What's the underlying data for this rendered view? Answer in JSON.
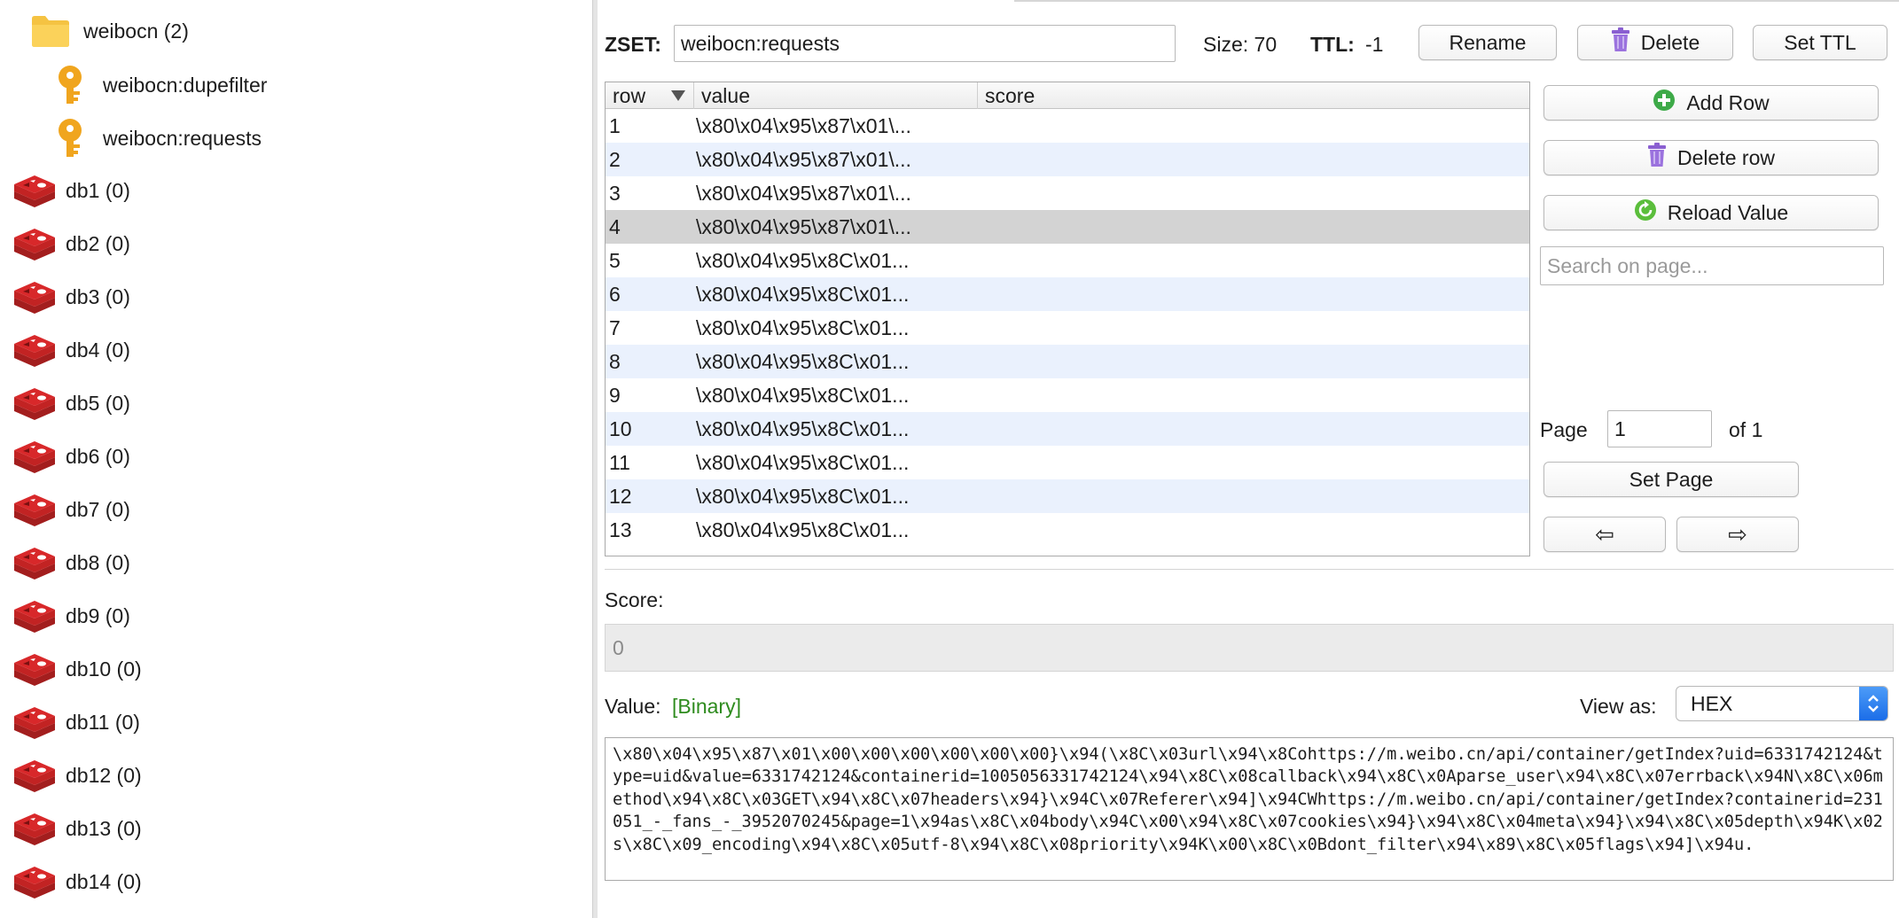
{
  "tree": {
    "folder": {
      "label": "weibocn (2)"
    },
    "keys": [
      {
        "label": "weibocn:dupefilter"
      },
      {
        "label": "weibocn:requests"
      }
    ],
    "databases": [
      {
        "label": "db1 (0)"
      },
      {
        "label": "db2 (0)"
      },
      {
        "label": "db3 (0)"
      },
      {
        "label": "db4 (0)"
      },
      {
        "label": "db5 (0)"
      },
      {
        "label": "db6 (0)"
      },
      {
        "label": "db7 (0)"
      },
      {
        "label": "db8 (0)"
      },
      {
        "label": "db9 (0)"
      },
      {
        "label": "db10 (0)"
      },
      {
        "label": "db11 (0)"
      },
      {
        "label": "db12 (0)"
      },
      {
        "label": "db13 (0)"
      },
      {
        "label": "db14 (0)"
      }
    ]
  },
  "key_header": {
    "type_label": "ZSET:",
    "key_name": "weibocn:requests",
    "size_text": "Size: 70",
    "ttl_label": "TTL:",
    "ttl_value": "-1",
    "rename_label": "Rename",
    "delete_label": "Delete",
    "set_ttl_label": "Set TTL"
  },
  "table": {
    "columns": [
      "row",
      "value",
      "score"
    ],
    "rows": [
      {
        "row": "1",
        "value": "\\x80\\x04\\x95\\x87\\x01\\..."
      },
      {
        "row": "2",
        "value": "\\x80\\x04\\x95\\x87\\x01\\..."
      },
      {
        "row": "3",
        "value": "\\x80\\x04\\x95\\x87\\x01\\..."
      },
      {
        "row": "4",
        "value": "\\x80\\x04\\x95\\x87\\x01\\..."
      },
      {
        "row": "5",
        "value": "\\x80\\x04\\x95\\x8C\\x01..."
      },
      {
        "row": "6",
        "value": "\\x80\\x04\\x95\\x8C\\x01..."
      },
      {
        "row": "7",
        "value": "\\x80\\x04\\x95\\x8C\\x01..."
      },
      {
        "row": "8",
        "value": "\\x80\\x04\\x95\\x8C\\x01..."
      },
      {
        "row": "9",
        "value": "\\x80\\x04\\x95\\x8C\\x01..."
      },
      {
        "row": "10",
        "value": "\\x80\\x04\\x95\\x8C\\x01..."
      },
      {
        "row": "11",
        "value": "\\x80\\x04\\x95\\x8C\\x01..."
      },
      {
        "row": "12",
        "value": "\\x80\\x04\\x95\\x8C\\x01..."
      },
      {
        "row": "13",
        "value": "\\x80\\x04\\x95\\x8C\\x01..."
      }
    ]
  },
  "side": {
    "add_row_label": "Add Row",
    "delete_row_label": "Delete row",
    "reload_label": "Reload Value",
    "search_placeholder": "Search on page...",
    "page_label": "Page",
    "page_value": "1",
    "of_text": "of 1",
    "set_page_label": "Set Page",
    "prev_glyph": "⇦",
    "next_glyph": "⇨"
  },
  "score": {
    "label": "Score:",
    "value": "0"
  },
  "value_section": {
    "label": "Value:",
    "binary_tag": "[Binary]",
    "view_as_label": "View as:",
    "view_as_selected": "HEX",
    "content": "\\x80\\x04\\x95\\x87\\x01\\x00\\x00\\x00\\x00\\x00\\x00}\\x94(\\x8C\\x03url\\x94\\x8Cohttps://m.weibo.cn/api/container/getIndex?uid=6331742124&type=uid&value=6331742124&containerid=1005056331742124\\x94\\x8C\\x08callback\\x94\\x8C\\x0Aparse_user\\x94\\x8C\\x07errback\\x94N\\x8C\\x06method\\x94\\x8C\\x03GET\\x94\\x8C\\x07headers\\x94}\\x94C\\x07Referer\\x94]\\x94CWhttps://m.weibo.cn/api/container/getIndex?containerid=231051_-_fans_-_3952070245&page=1\\x94as\\x8C\\x04body\\x94C\\x00\\x94\\x8C\\x07cookies\\x94}\\x94\\x8C\\x04meta\\x94}\\x94\\x8C\\x05depth\\x94K\\x02s\\x8C\\x09_encoding\\x94\\x8C\\x05utf-8\\x94\\x8C\\x08priority\\x94K\\x00\\x8C\\x0Bdont_filter\\x94\\x89\\x8C\\x05flags\\x94]\\x94u."
  },
  "colors": {
    "folder": "#F5C342",
    "key_icon": "#F0A51E",
    "redis_red": "#D8282A",
    "selected_row": "#D3D3D3",
    "alt_row": "#EAF1FD",
    "binary_green": "#2E8B1E",
    "add_green": "#3DAA48",
    "trash_purple": "#8A5FD1"
  }
}
